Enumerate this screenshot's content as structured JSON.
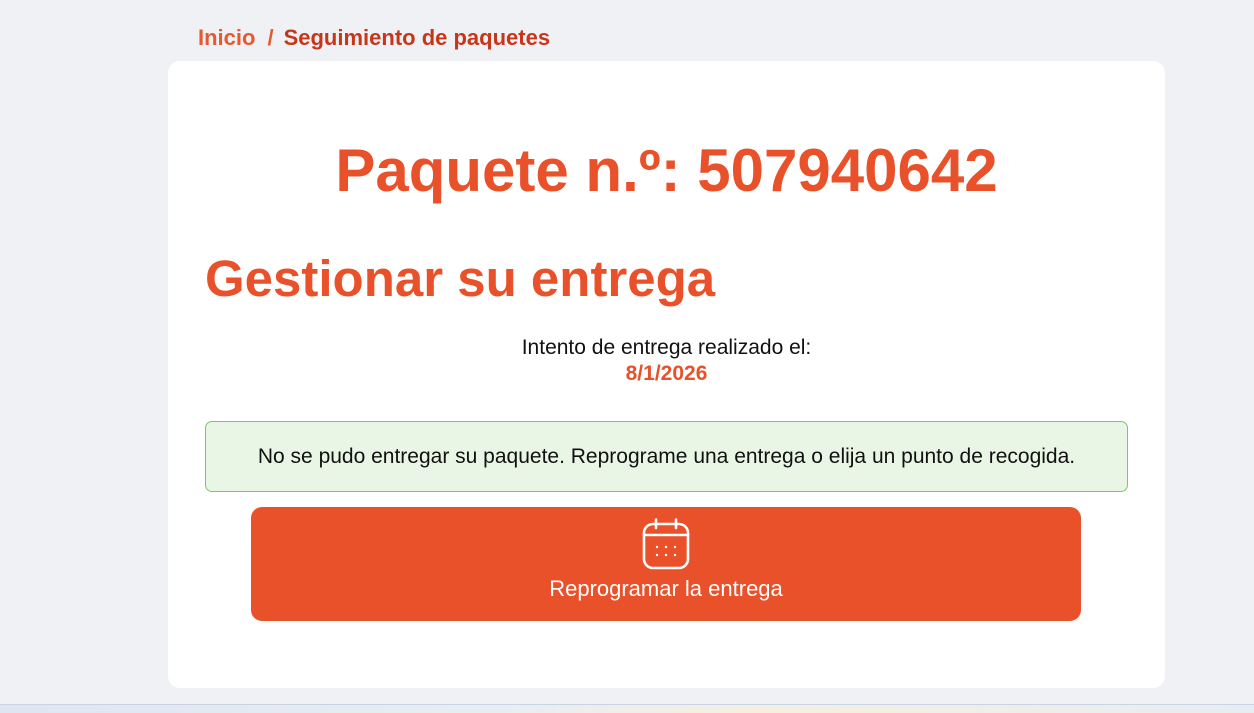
{
  "breadcrumb": {
    "home": "Inicio",
    "separator": "/",
    "current": "Seguimiento de paquetes"
  },
  "package": {
    "title": "Paquete n.º: 507940642"
  },
  "delivery": {
    "heading": "Gestionar su entrega",
    "attempt_label": "Intento de entrega realizado el:",
    "attempt_date": "8/1/2026",
    "alert_message": "No se pudo entregar su paquete. Reprograme una entrega o elija un punto de recogida."
  },
  "actions": {
    "reschedule_label": "Reprogramar la entrega",
    "reschedule_icon": "calendar-icon"
  },
  "colors": {
    "accent": "#e9512a",
    "alert_bg": "#e9f6e5",
    "alert_border": "#7cc76a",
    "page_bg": "#f0f1f5"
  }
}
